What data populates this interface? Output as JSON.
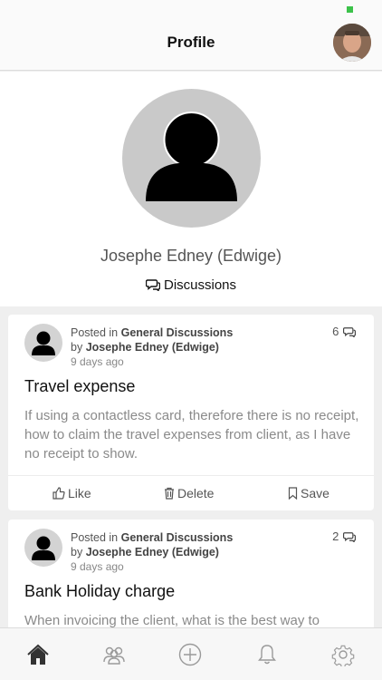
{
  "header": {
    "title": "Profile"
  },
  "profile": {
    "name": "Josephe Edney (Edwige)",
    "discussions_label": "Discussions"
  },
  "posts": [
    {
      "posted_in_prefix": "Posted in",
      "category": "General Discussions",
      "by_prefix": "by",
      "author": "Josephe Edney (Edwige)",
      "ago": "9 days ago",
      "comment_count": "6",
      "title": "Travel expense",
      "body": "If using a contactless card, therefore there is no receipt, how to claim the travel expenses from client, as I have no receipt to show.",
      "like_label": "Like",
      "delete_label": "Delete",
      "save_label": "Save"
    },
    {
      "posted_in_prefix": "Posted in",
      "category": "General Discussions",
      "by_prefix": "by",
      "author": "Josephe Edney (Edwige)",
      "ago": "9 days ago",
      "comment_count": "2",
      "title": "Bank Holiday charge",
      "body": "When invoicing the client, what is the best way to"
    }
  ],
  "tabbar": {
    "icons": [
      "home-icon",
      "community-icon",
      "add-icon",
      "bell-icon",
      "gear-icon"
    ],
    "active_color": "#333333",
    "inactive_color": "#9a9a9a"
  }
}
